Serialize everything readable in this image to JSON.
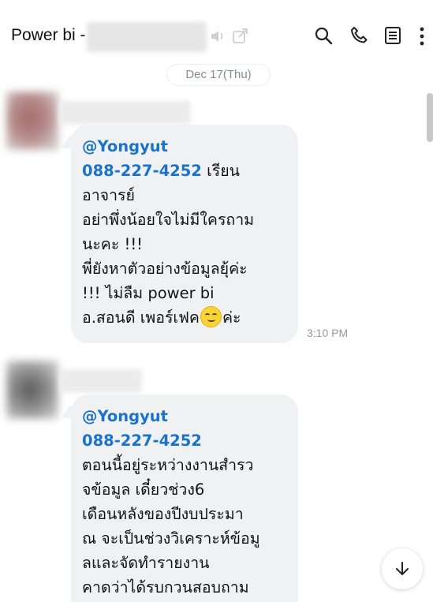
{
  "header": {
    "title": "Power bi -",
    "icons": [
      "mute-icon",
      "popout-icon",
      "search-icon",
      "phone-icon",
      "notes-icon",
      "more-icon"
    ]
  },
  "date_divider": "Dec 17(Thu)",
  "messages": [
    {
      "mention": "@Yongyut",
      "phone": "088-227-4252",
      "after_phone": " เรียน",
      "lines": [
        "อาจารย์",
        "อย่าพึ่งน้อยใจไม่มีใครถาม",
        "นะคะ !!!",
        "พี่ยังหาตัวอย่างข้อมูลยุ้ค่ะ",
        "!!! ไม่ลืม power bi"
      ],
      "last_before_emoji": "อ.สอนดี เพอร์เฟค",
      "last_after_emoji": "ค่ะ",
      "time": "3:10 PM"
    },
    {
      "mention": "@Yongyut",
      "phone": "088-227-4252",
      "lines": [
        "ตอนนี้อยู่ระหว่างงานสำรว",
        "จข้อมูล  เดี๋ยวช่วง6",
        "เดือนหลังของปีงบประมา",
        "ณ จะเป็นช่วงวิเคราะห์ข้อมู",
        "ลและจัดทำรายงาน",
        "คาดว่าได้รบกวนสอบถาม"
      ]
    }
  ],
  "colors": {
    "mention": "#1b73c9",
    "bubble": "#f0f1f3",
    "muted_text": "#858c96"
  }
}
